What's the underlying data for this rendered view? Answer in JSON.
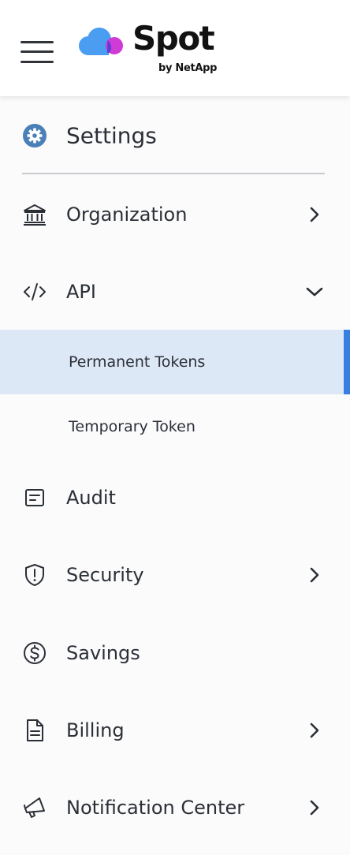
{
  "brand": {
    "name": "Spot",
    "byline": "by NetApp",
    "colors": {
      "cloud_blue": "#4a9df0",
      "dot_magenta": "#d03ad6",
      "overlap": "#5b3fd0"
    }
  },
  "header": {
    "menu_icon": "hamburger-icon"
  },
  "settings": {
    "title": "Settings",
    "icon": "gear-icon"
  },
  "menu": {
    "organization": {
      "label": "Organization",
      "icon": "bank-icon",
      "expanded": false
    },
    "api": {
      "label": "API",
      "icon": "code-icon",
      "expanded": true,
      "children": [
        {
          "label": "Permanent Tokens",
          "active": true
        },
        {
          "label": "Temporary Token",
          "active": false
        }
      ]
    },
    "audit": {
      "label": "Audit",
      "icon": "audit-icon"
    },
    "security": {
      "label": "Security",
      "icon": "shield-icon",
      "expanded": false
    },
    "savings": {
      "label": "Savings",
      "icon": "dollar-circle-icon"
    },
    "billing": {
      "label": "Billing",
      "icon": "document-icon",
      "expanded": false
    },
    "notification_center": {
      "label": "Notification Center",
      "icon": "megaphone-icon",
      "expanded": false
    }
  },
  "colors": {
    "active_bg": "#dde8f7",
    "active_bar": "#3a7fe0",
    "settings_icon": "#4a7fb8",
    "text": "#2b2f36"
  }
}
